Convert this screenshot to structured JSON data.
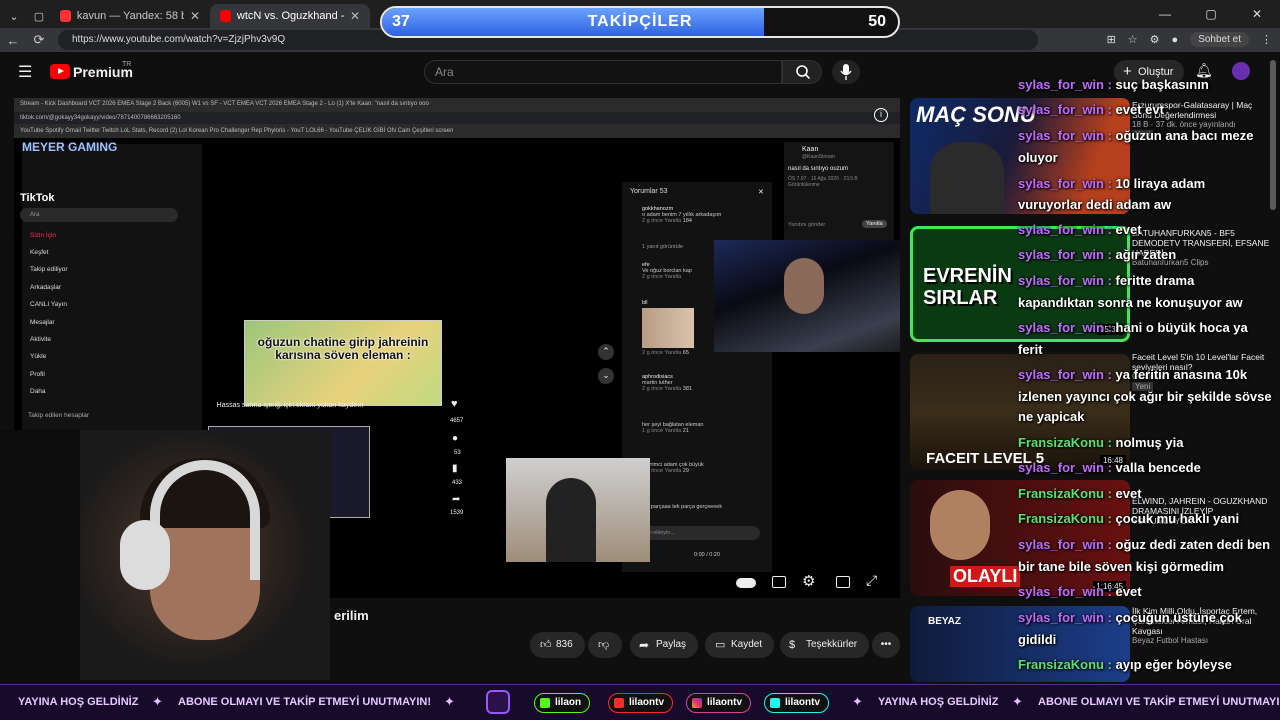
{
  "browser": {
    "tabs": [
      {
        "label": "kavun — Yandex: 58 bin sonuç bu",
        "color": "#f33"
      },
      {
        "label": "wtcN vs. Oguzkhand - Jahrein",
        "color": "#f00",
        "active": true
      }
    ],
    "url": "https://www.youtube.com/watch?v=ZjzjPhv3v9Q",
    "sohbet_label": "Sohbet et"
  },
  "goal": {
    "title": "TAKİPÇİLER",
    "current": "37",
    "target": "50",
    "progress": 0.74
  },
  "youtube": {
    "logo_text": "Premium",
    "logo_region": "TR",
    "search_placeholder": "Ara",
    "create_label": "Oluştur"
  },
  "inner_screen": {
    "chrome_tabs_row": "Stream - Kick Dashboard    VCT 2026 EMEA Stage 2 Back    (6005) W1 vs SF - VCT EMEA    VCT 2026 EMEA Stage 2 - Lo    (1) X'te Kaan: \"nasıl da sıntıyo ooo",
    "chrome_url_row": "tiktok.com/@gokayy34gokayy/video/7871400786663205160",
    "bookmarks_row": "YouTube   Spotify   Gmail   Twitter   Twitch   LoL Stats, Record   (2) Lol Korean Pro   Challenger Rep   Phyloris - YouT   LOL66 - YouTube   ÇELİK GİBİ ON   Cam Çeşitleri   screen",
    "meyer_logo": "MEYER GAMING",
    "tiktok_logo": "TikTok",
    "tiktok_search": "Ara",
    "tiktok_menu": [
      "Sizin İçin",
      "Keşfet",
      "Takip ediliyor",
      "Arkadaşlar",
      "CANLI Yayın",
      "Mesajlar",
      "Aktivite",
      "Yükle",
      "Profil",
      "Daha"
    ],
    "followed_header": "Takip edilen hesaplar",
    "meme_caption": "oğuzun chatine girip jahreinin karısına söven eleman :",
    "sensitive_text": "Hassas sarma içeriği için ekranı yukarı kaydırın",
    "likes_count": "4657",
    "comments_count": "53",
    "saves_count": "433",
    "shares_count": "1539",
    "comments_header": "Yorumlar 53",
    "comments": [
      {
        "user": "gokkhanozm",
        "text": "o adam benim 7 yıllık arkadaşım",
        "meta": "2 g önce   Yanıtla",
        "likes": "184"
      },
      {
        "user": "",
        "text": "1 yanıt görüntüle",
        "meta": "",
        "likes": ""
      },
      {
        "user": "efe",
        "text": "Ve oğuz borclan kap",
        "meta": "2 g önce   Yanıtla",
        "likes": ""
      },
      {
        "user": "bll",
        "text": "",
        "meta": "2 g önce   Yanıtla",
        "likes": "65"
      },
      {
        "user": "aphrodisiacs",
        "text": "martin luther",
        "meta": "2 g önce   Yanıtla",
        "likes": "381"
      },
      {
        "user": "",
        "text": "her şeyi bağlatan eleman",
        "meta": "1 g önce   Yanıtla",
        "likes": "21"
      },
      {
        "user": "",
        "text": "sevrimci adam çok büyük",
        "meta": "2 g önce   Yanıtla",
        "likes": "29"
      },
      {
        "user": "",
        "text": "tek parçaaa tek parça gerçeeeek",
        "meta": "",
        "likes": ""
      }
    ],
    "comment_placeholder": "Yorum ekleyin...",
    "tweet_user": "Kaan",
    "tweet_handle": "@KaanStream",
    "tweet_text": "nasıl da sıntıyo ouzum",
    "tweet_meta": "ÖS 7.07 · 16 Ağu 2026 · 23,5 B Görüntülenme",
    "reply_placeholder": "Yanıtını gönder",
    "reply_button": "Yanıtla",
    "playback_time": "0:00 / 0:20"
  },
  "video": {
    "title_fragment": "erilim",
    "likes": "836",
    "share_label": "Paylaş",
    "save_label": "Kaydet",
    "thanks_label": "Teşekkürler"
  },
  "recommendations": [
    {
      "title": "Erzurumspor-Galatasaray | Maç Sonu Değerlendirmesi",
      "meta": "18 B · 37 dk. önce yayınlandı",
      "badge": "Yeni",
      "thumb_text": "MAÇ SONU",
      "duration": ""
    },
    {
      "title": "BATUHANFURKAN5 - BF5 DEMODETV TRANSFERİ, EFSANE HABERİ",
      "meta": "Batuhanfurkan5 Clips",
      "badge": "",
      "thumb_text": "EVRENİN SIRLAR",
      "duration": "35:33"
    },
    {
      "title": "Faceit Level 5'in 10 Level'lar Faceit seviyeleri nasıl?",
      "meta": "GinHoshi",
      "badge": "Yeni",
      "thumb_text": "FACEIT LEVEL 5",
      "duration": "16:48"
    },
    {
      "title": "ELWIND, JAHREIN - OGUZKHAND DRAMASINI İZLEYİP YORUMLUYOR",
      "meta": "",
      "badge": "",
      "thumb_text": "OLAYLI",
      "duration": "1:16:45"
    },
    {
      "title": "İlk Kim Milli Oldu, İsportaç Ertem, Çarkmekler Arması, Hakan Ural Kavgası",
      "meta": "Beyaz Futbol Hastası",
      "badge": "",
      "thumb_text": "BEYAZ",
      "duration": ""
    }
  ],
  "chat": [
    {
      "user": "sylas_for_win",
      "msg": "suç başkasının",
      "green": false
    },
    {
      "user": "sylas_for_win",
      "msg": "evet evt",
      "green": false
    },
    {
      "user": "sylas_for_win",
      "msg": "oğuzun ana bacı meze",
      "green": false
    },
    {
      "user": "",
      "msg": "oluyor",
      "green": false
    },
    {
      "user": "sylas_for_win",
      "msg": "10 liraya adam",
      "green": false
    },
    {
      "user": "",
      "msg": "vuruyorlar dedi adam aw",
      "green": false
    },
    {
      "user": "sylas_for_win",
      "msg": "evet",
      "green": false
    },
    {
      "user": "sylas_for_win",
      "msg": "ağır zaten",
      "green": false
    },
    {
      "user": "sylas_for_win",
      "msg": "feritte drama",
      "green": false
    },
    {
      "user": "",
      "msg": "kapandıktan sonra ne konuşuyor aw",
      "green": false
    },
    {
      "user": "sylas_for_win",
      "msg": "hani o büyük hoca ya",
      "green": false
    },
    {
      "user": "",
      "msg": "ferit",
      "green": false
    },
    {
      "user": "sylas_for_win",
      "msg": "ya feritin anasına 10k",
      "green": false
    },
    {
      "user": "",
      "msg": "izlenen yayıncı çok ağır bir şekilde sövse",
      "green": false
    },
    {
      "user": "",
      "msg": "ne yapicak",
      "green": false
    },
    {
      "user": "FransizaKonu",
      "msg": "nolmuş yia",
      "green": true
    },
    {
      "user": "sylas_for_win",
      "msg": "valla bencede",
      "green": false
    },
    {
      "user": "FransizaKonu",
      "msg": "evet",
      "green": true
    },
    {
      "user": "FransizaKonu",
      "msg": "çocuk mu haklı yani",
      "green": true
    },
    {
      "user": "sylas_for_win",
      "msg": "oğuz dedi zaten dedi ben",
      "green": false
    },
    {
      "user": "",
      "msg": "bir tane bile söven kişi görmedim",
      "green": false
    },
    {
      "user": "sylas_for_win",
      "msg": "evet",
      "green": false
    },
    {
      "user": "sylas_for_win",
      "msg": "çocuğun üstüne çok",
      "green": false
    },
    {
      "user": "",
      "msg": "gidildi",
      "green": false
    },
    {
      "user": "FransizaKonu",
      "msg": "ayıp eğer böyleyse",
      "green": true
    }
  ],
  "ticker": {
    "welcome": "YAYINA HOŞ GELDİNİZ",
    "subscribe": "ABONE OLMAYI VE TAKİP ETMEYİ UNUTMAYIN!",
    "welcome2": "YAYINA HOŞ GELDİNİZ",
    "subscribe2": "ABONE OLMAYI VE TAKİP ETMEYİ UNUTMAYIN!",
    "kick": "lilaon",
    "youtube": "lilaontv",
    "instagram": "lilaontv",
    "tiktok": "lilaontv",
    "welcome0": "YAYINA HOŞ GELDİNİZ"
  }
}
